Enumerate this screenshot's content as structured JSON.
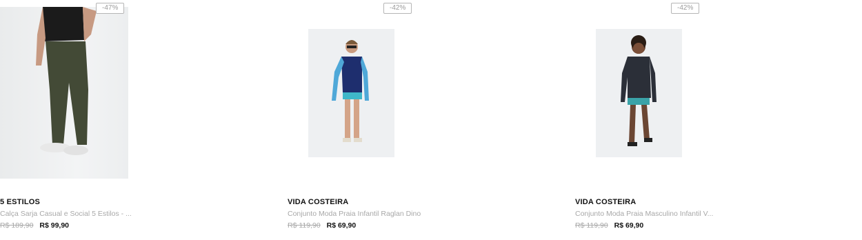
{
  "products": [
    {
      "discount": "-47%",
      "brand": "5 ESTILOS",
      "title": "Calça Sarja Casual e Social 5 Estilos - ...",
      "old_price": "R$ 189,90",
      "price": "R$ 99,90"
    },
    {
      "discount": "-42%",
      "brand": "VIDA COSTEIRA",
      "title": "Conjunto Moda Praia Infantil Raglan Dino",
      "old_price": "R$ 119,90",
      "price": "R$ 69,90"
    },
    {
      "discount": "-42%",
      "brand": "VIDA COSTEIRA",
      "title": "Conjunto Moda Praia Masculino Infantil V...",
      "old_price": "R$ 119,90",
      "price": "R$ 69,90"
    }
  ]
}
